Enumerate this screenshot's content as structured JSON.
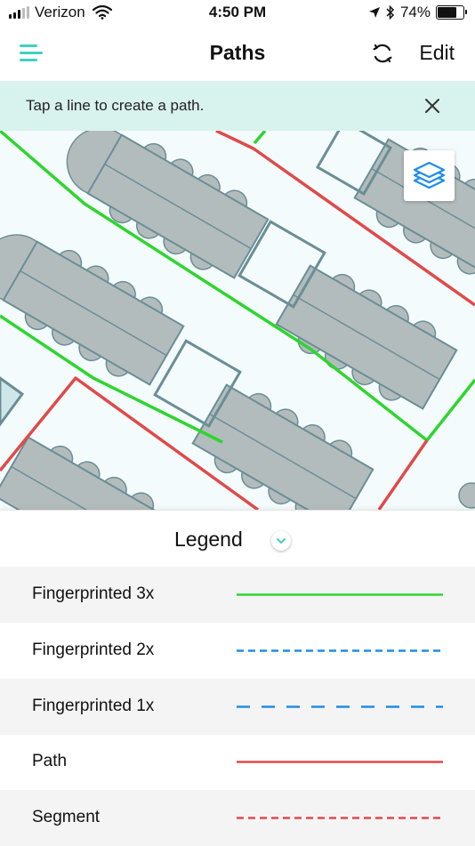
{
  "status_bar": {
    "carrier": "Verizon",
    "time": "4:50 PM",
    "battery_percent": "74%",
    "battery_level": 0.74,
    "icons": [
      "signal-icon",
      "wifi-icon",
      "location-arrow-icon",
      "bluetooth-icon",
      "battery-icon"
    ]
  },
  "nav": {
    "title": "Paths",
    "edit_label": "Edit",
    "icons": [
      "hamburger-menu-icon",
      "sync-icon"
    ]
  },
  "banner": {
    "text": "Tap a line to create a path.",
    "icon": "close-icon"
  },
  "map": {
    "icon": "layers-icon"
  },
  "legend": {
    "title": "Legend",
    "toggle_icon": "chevron-down-icon",
    "items": [
      {
        "label": "Fingerprinted 3x",
        "color": "#2fd52f",
        "style": "solid"
      },
      {
        "label": "Fingerprinted 2x",
        "color": "#1e8de8",
        "style": "dashed-short"
      },
      {
        "label": "Fingerprinted 1x",
        "color": "#1e8de8",
        "style": "dashed-long"
      },
      {
        "label": "Path",
        "color": "#e04a4a",
        "style": "solid"
      },
      {
        "label": "Segment",
        "color": "#e04a4a",
        "style": "dashed-short"
      }
    ]
  },
  "colors": {
    "accent": "#3fd1c1",
    "banner_bg": "#d8f2ee",
    "map_bg": "#f4fbfc",
    "table_fill": "#b3bcbc",
    "table_stroke": "#6a8e96",
    "green": "#2fd52f",
    "red": "#e04a4a",
    "blue": "#1e8de8"
  }
}
